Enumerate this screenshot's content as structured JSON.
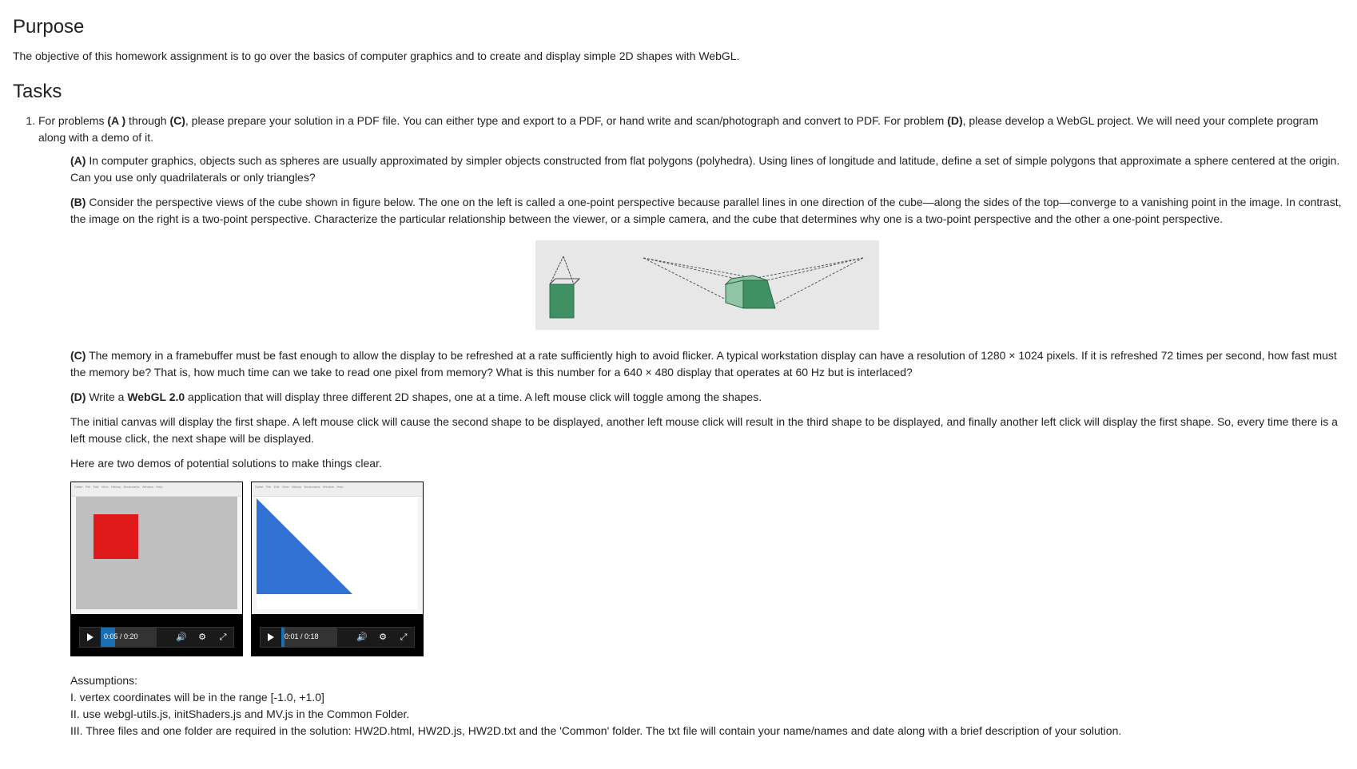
{
  "purpose": {
    "heading": "Purpose",
    "text": "The objective of this homework assignment is to go over the basics of computer graphics and to create and display simple 2D shapes with WebGL."
  },
  "tasks": {
    "heading": "Tasks",
    "intro": {
      "pre": "For problems ",
      "b1": "(A )",
      "mid1": " through ",
      "b2": "(C)",
      "mid2": ",  please prepare your solution in a PDF file. You can either type and export to a PDF, or hand write and scan/photograph and convert to PDF. For problem ",
      "b3": "(D)",
      "post": ", please develop a WebGL project. We will need your complete program along with a demo of it."
    },
    "a": {
      "label": "(A)",
      "text": " In computer graphics, objects such as spheres are usually approximated by simpler objects constructed from flat polygons (polyhedra). Using lines of longitude and latitude, define a set of simple polygons that approximate a sphere centered at the origin. Can you use only quadrilaterals or only triangles?"
    },
    "b": {
      "label": "(B)",
      "text": " Consider the perspective views of the cube shown in figure below. The one on the left is called a one-point perspective because parallel lines in one direction of the cube—along the sides of the top—converge to a vanishing point in the image. In contrast, the image on the right is a two-point perspective. Characterize the particular relationship between the viewer, or a simple camera, and the cube that determines why one is a two-point perspective and the other a one-point perspective."
    },
    "c": {
      "label": "(C)",
      "text": " The memory in a framebuffer must be fast enough to allow the display to be refreshed at a rate sufficiently high to avoid flicker. A typical workstation display can have a resolution of 1280 × 1024 pixels. If it is refreshed 72 times per second, how fast must the memory be? That is, how much time can we take to read one pixel from memory? What is this number for a 640 × 480 display that operates at 60 Hz but is interlaced?"
    },
    "d": {
      "label": "(D)",
      "pre": " Write a ",
      "bold": "WebGL 2.0",
      "post": " application that  will display three different 2D shapes, one at a time. A left mouse click will toggle among the shapes."
    },
    "d_p2": "The initial canvas will display the first shape. A left mouse click will cause the second shape to be displayed, another left mouse click will result in the third shape to be displayed, and finally another left click will display the first shape. So, every time there is a left mouse click, the next shape will be displayed.",
    "d_p3": "Here are two demos of potential solutions to make things clear.",
    "assumptions": {
      "heading": "Assumptions:",
      "i": "I. vertex coordinates will be in the range [-1.0, +1.0]",
      "ii": "II. use webgl-utils.js, initShaders.js and MV.js in the Common Folder.",
      "iii": "III. Three files and one folder are required in the solution: HW2D.html, HW2D.js, HW2D.txt and the 'Common' folder. The txt file will contain your name/names and date along with a brief description of your solution."
    }
  },
  "video1": {
    "time": "0:05 / 0:20",
    "progress_pct": 25
  },
  "video2": {
    "time": "0:01 / 0:18",
    "progress_pct": 6
  }
}
